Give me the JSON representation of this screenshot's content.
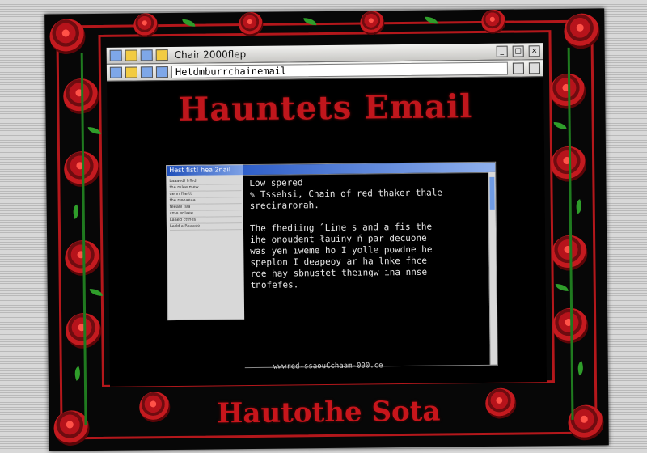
{
  "window": {
    "title": "Chair 2000ﬂep",
    "address": "Hetdmburrchainemail",
    "controls": {
      "minimize": "_",
      "maximize": "□",
      "close": "×"
    }
  },
  "banner": {
    "title": "Hauntets Email"
  },
  "mail_client": {
    "popup_title": "Hest fist! hea 2nail",
    "list_items": [
      "Laaaedl frfhdl",
      "the rulee mew",
      "uenn fhe tt",
      "the rreoaeaa",
      "teeanl lsia",
      "cme enlaee",
      "Laaed ctthes",
      "Ladd a Raaaee"
    ],
    "message_lines": [
      "Low spered",
      "✎  Tssehsi, Chain of red thaker thale",
      "   srecirarorah.",
      "",
      "   The fhediing ˆLine's and a fis the",
      "   ihe onoudent łauiny ń par decuone",
      "   was yen ıweme ho I yolle powdne he",
      "   speplon I deapeoy ar ha lnke fhce",
      "   roe hay sbnustet theıngw ina nnse",
      "   tnofefes."
    ],
    "footer_url": "wwwred-ssaouCchaam-000.ce"
  },
  "frame": {
    "signature": "Hautothe Sota"
  },
  "colors": {
    "rose_red": "#b6131b",
    "leaf_green": "#2f9d2a",
    "window_blue": "#2f5fc9"
  }
}
